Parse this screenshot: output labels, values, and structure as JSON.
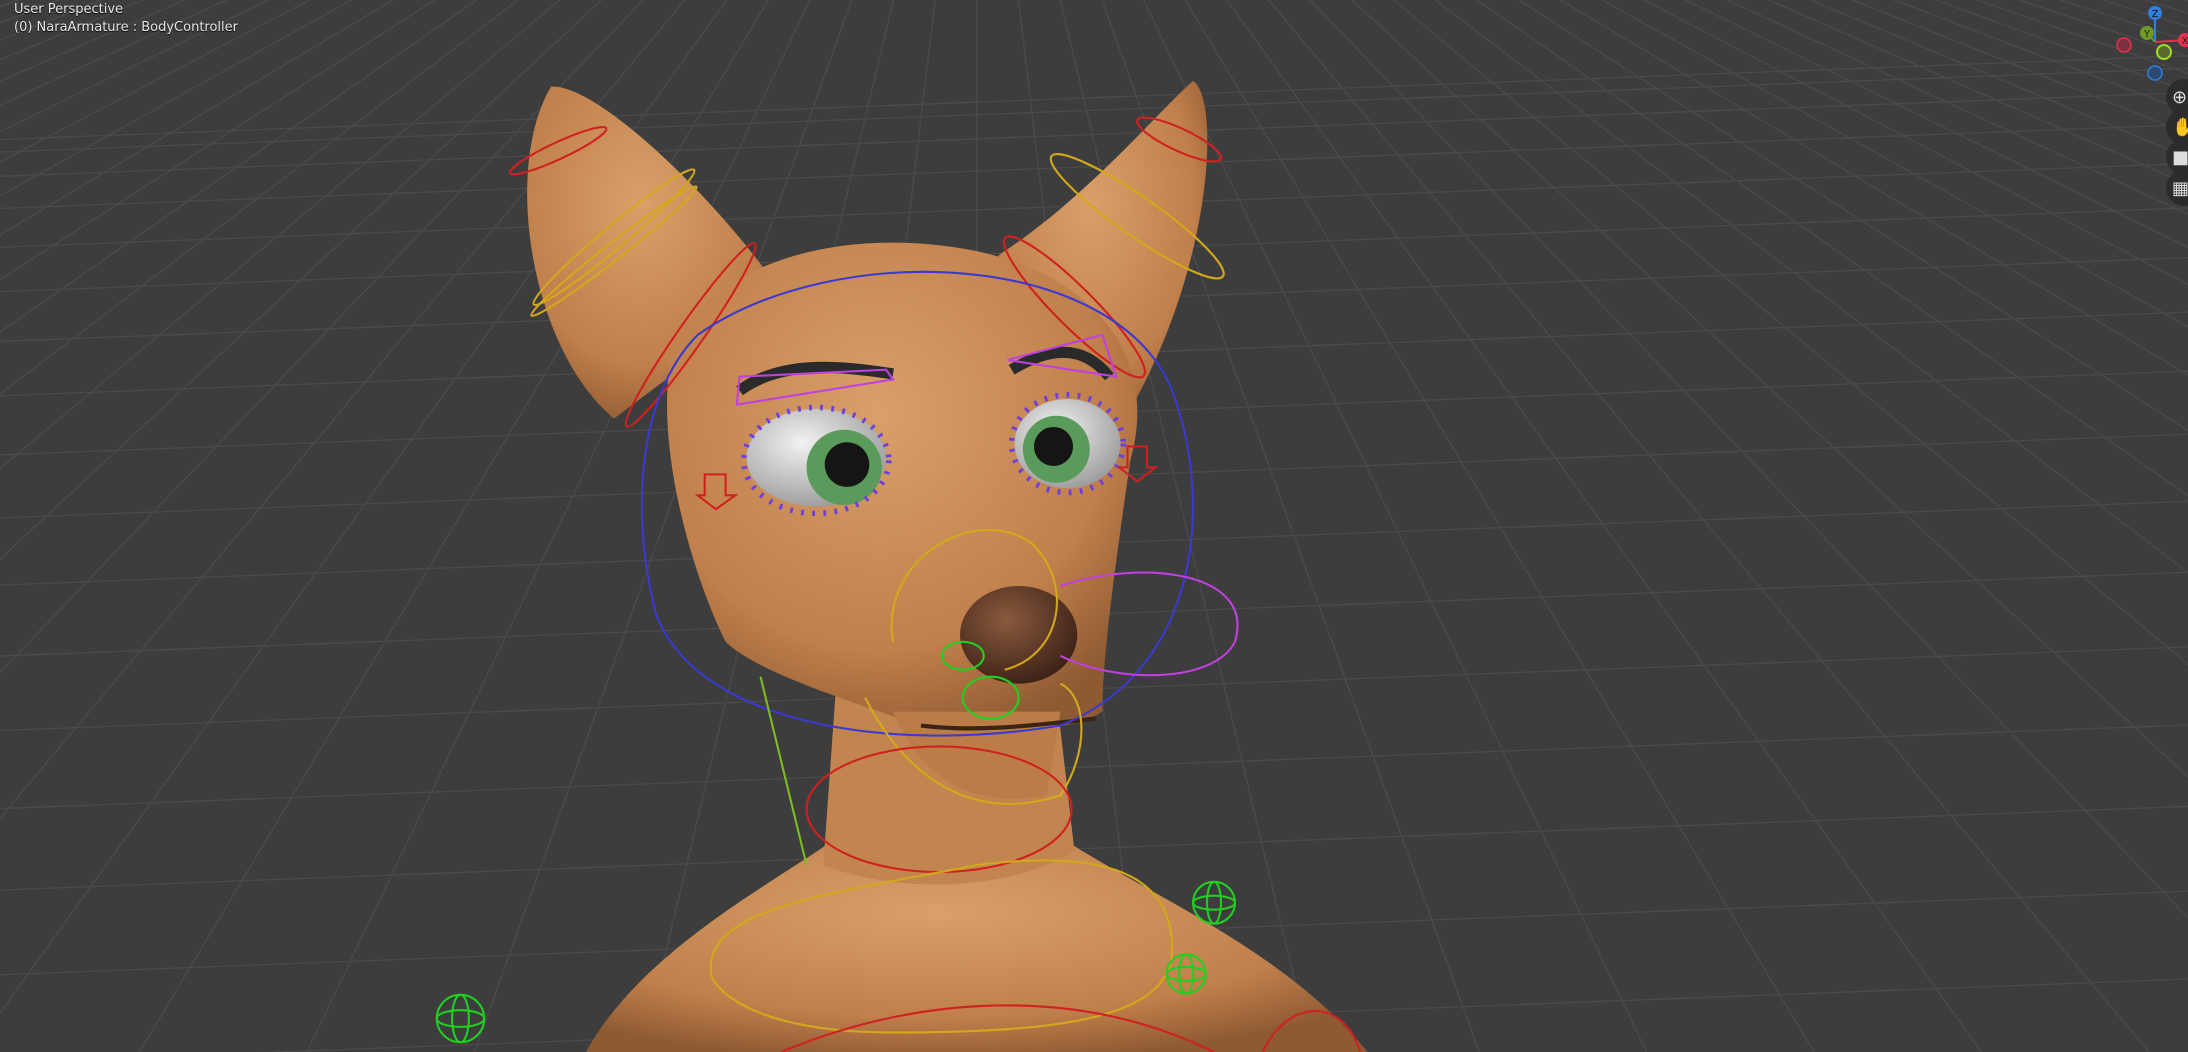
{
  "viewport": {
    "view_name": "User Perspective",
    "active_object": "(0) NaraArmature : BodyController"
  },
  "gizmo": {
    "axes": [
      {
        "label": "Z",
        "color": "#2f7fe0"
      },
      {
        "label": "Y",
        "color": "#6e9a25"
      },
      {
        "label": "X",
        "color": "#e0344c"
      }
    ]
  },
  "nav_buttons": [
    {
      "name": "zoom",
      "icon": "magnifier-plus-icon"
    },
    {
      "name": "pan",
      "icon": "hand-icon"
    },
    {
      "name": "camera",
      "icon": "camera-icon"
    },
    {
      "name": "ortho-toggle",
      "icon": "grid-icon"
    }
  ],
  "colors": {
    "background": "#3d3d3d",
    "skin": "#c98a55",
    "bone_selected": "#c040e0",
    "bone_yellow": "#d4a81c",
    "bone_red": "#d02020",
    "bone_blue": "#3a3ad0",
    "bone_green": "#20d020"
  }
}
